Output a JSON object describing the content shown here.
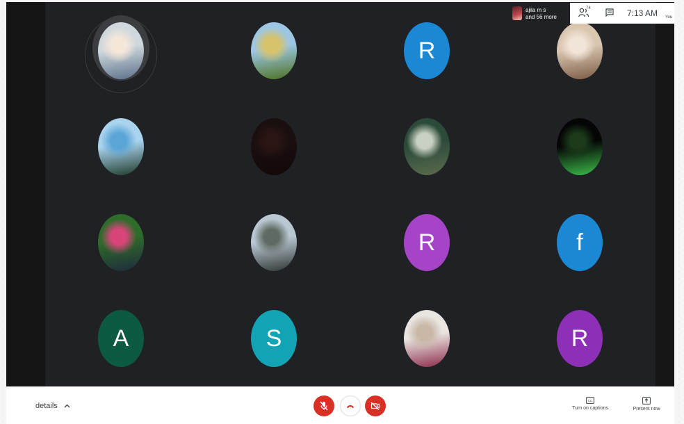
{
  "top_bar": {
    "presenter_name": "ajila m s",
    "presenter_more": "and 56 more",
    "participants_count": "74",
    "time": "7:13 AM",
    "you_label": "You"
  },
  "tiles": [
    {
      "type": "photo",
      "name": "participant-1-laptop-man",
      "colors": [
        "#cfd8dc",
        "#f4e6d9",
        "#5a6f8a"
      ]
    },
    {
      "type": "photo",
      "name": "participant-2-sunflower-sky",
      "colors": [
        "#9dc6e3",
        "#d6c36b",
        "#4a6f1e"
      ]
    },
    {
      "type": "initial",
      "letter": "R",
      "color": "#1a88d4"
    },
    {
      "type": "photo",
      "name": "participant-4-girl-hijab",
      "colors": [
        "#d9c6b0",
        "#f2e4d8",
        "#7a5a44"
      ]
    },
    {
      "type": "photo",
      "name": "participant-5-tree",
      "colors": [
        "#a9d3ee",
        "#5aa5d6",
        "#1e3a28"
      ]
    },
    {
      "type": "photo",
      "name": "participant-6-dark",
      "colors": [
        "#1a0f0f",
        "#2a1414",
        "#120808"
      ]
    },
    {
      "type": "photo",
      "name": "participant-7-outdoor-boy",
      "colors": [
        "#2c4a3a",
        "#c9d2c2",
        "#5b6b4e"
      ]
    },
    {
      "type": "photo",
      "name": "participant-8-gaming-logo",
      "colors": [
        "#050505",
        "#1a3a1a",
        "#3cbf4a"
      ]
    },
    {
      "type": "photo",
      "name": "participant-9-girl-garden",
      "colors": [
        "#2f6b2a",
        "#d7457a",
        "#1e2a3c"
      ]
    },
    {
      "type": "photo",
      "name": "participant-10-group-trees",
      "colors": [
        "#b9c7d3",
        "#5f6b62",
        "#2e3530"
      ]
    },
    {
      "type": "initial",
      "letter": "R",
      "color": "#a544c6"
    },
    {
      "type": "initial",
      "letter": "f",
      "color": "#1a88d4"
    },
    {
      "type": "initial",
      "letter": "A",
      "color": "#0d5a43"
    },
    {
      "type": "initial",
      "letter": "S",
      "color": "#12a4b4"
    },
    {
      "type": "photo",
      "name": "participant-15-girl-scarf",
      "colors": [
        "#e9e6e1",
        "#c9b8a8",
        "#8c2a4a"
      ]
    },
    {
      "type": "initial",
      "letter": "R",
      "color": "#8e2fb7"
    }
  ],
  "bottom_bar": {
    "details_label": "details",
    "captions_label": "Turn on captions",
    "present_label": "Present now"
  }
}
